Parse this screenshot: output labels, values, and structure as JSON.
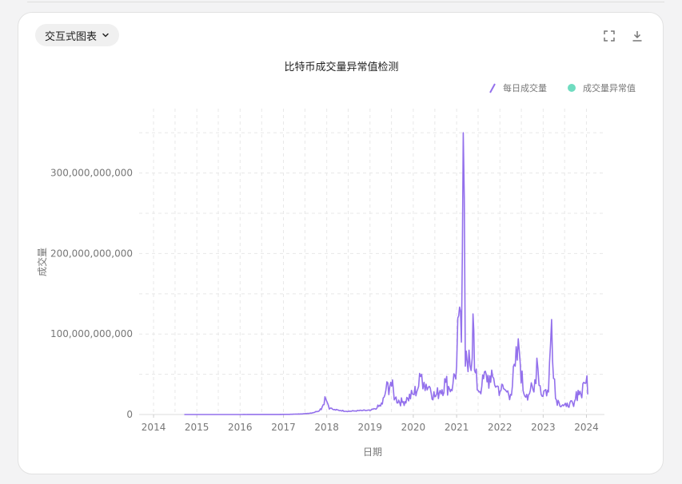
{
  "toolbar": {
    "chart_type_label": "交互式图表",
    "fullscreen_icon": "fullscreen-icon",
    "download_icon": "download-icon"
  },
  "colors": {
    "series_line": "#9370ec",
    "anomaly_marker": "#6fdcc0",
    "grid": "#e8e8e8",
    "axis_text": "#777777"
  },
  "chart_data": {
    "type": "line",
    "title": "比特币成交量异常值检测",
    "xlabel": "日期",
    "ylabel": "成交量",
    "xlim": [
      "2013-09-01",
      "2024-06-01"
    ],
    "ylim": [
      0,
      380000000000
    ],
    "x_ticks": [
      "2014",
      "2015",
      "2016",
      "2017",
      "2018",
      "2019",
      "2020",
      "2021",
      "2022",
      "2023",
      "2024"
    ],
    "y_ticks": [
      {
        "value": 0,
        "label": "0"
      },
      {
        "value": 100000000000,
        "label": "100,000,000,000"
      },
      {
        "value": 200000000000,
        "label": "200,000,000,000"
      },
      {
        "value": 300000000000,
        "label": "300,000,000,000"
      }
    ],
    "grid": true,
    "legend_position": "top-right",
    "legend": [
      {
        "label": "每日成交量",
        "kind": "line"
      },
      {
        "label": "成交量异常值",
        "kind": "marker"
      }
    ],
    "series": [
      {
        "name": "每日成交量",
        "x": [
          "2014-09-17",
          "2015-03-01",
          "2015-09-01",
          "2016-03-01",
          "2016-09-01",
          "2017-01-01",
          "2017-03-01",
          "2017-05-01",
          "2017-07-01",
          "2017-09-01",
          "2017-11-01",
          "2017-12-01",
          "2017-12-17",
          "2018-01-05",
          "2018-02-01",
          "2018-03-01",
          "2018-05-01",
          "2018-07-01",
          "2018-09-01",
          "2018-11-01",
          "2019-01-01",
          "2019-03-01",
          "2019-04-15",
          "2019-05-15",
          "2019-06-25",
          "2019-08-01",
          "2019-10-01",
          "2019-11-15",
          "2020-01-01",
          "2020-02-15",
          "2020-03-12",
          "2020-04-01",
          "2020-05-15",
          "2020-07-01",
          "2020-08-15",
          "2020-10-01",
          "2020-11-01",
          "2020-12-01",
          "2021-01-01",
          "2021-01-11",
          "2021-02-10",
          "2021-02-26",
          "2021-03-15",
          "2021-04-15",
          "2021-05-12",
          "2021-05-19",
          "2021-06-01",
          "2021-07-01",
          "2021-08-01",
          "2021-09-07",
          "2021-10-15",
          "2021-11-10",
          "2021-12-04",
          "2022-01-10",
          "2022-02-01",
          "2022-03-01",
          "2022-04-01",
          "2022-05-10",
          "2022-06-13",
          "2022-07-15",
          "2022-08-15",
          "2022-09-15",
          "2022-10-15",
          "2022-11-09",
          "2022-12-15",
          "2023-01-15",
          "2023-02-15",
          "2023-03-13",
          "2023-04-15",
          "2023-05-15",
          "2023-06-15",
          "2023-07-15",
          "2023-08-15",
          "2023-09-15",
          "2023-10-23",
          "2023-11-15",
          "2023-12-10",
          "2024-01-05",
          "2024-01-12"
        ],
        "values": [
          20000000,
          30000000,
          40000000,
          50000000,
          80000000,
          150000000,
          250000000,
          600000000,
          1000000000,
          2000000000,
          5000000000,
          12000000000,
          22000000000,
          15000000000,
          8000000000,
          6000000000,
          5000000000,
          4000000000,
          4500000000,
          5000000000,
          5000000000,
          8000000000,
          13000000000,
          30000000000,
          40000000000,
          20000000000,
          15000000000,
          20000000000,
          25000000000,
          35000000000,
          50000000000,
          40000000000,
          35000000000,
          22000000000,
          30000000000,
          40000000000,
          32000000000,
          38000000000,
          60000000000,
          120000000000,
          90000000000,
          350000000000,
          60000000000,
          80000000000,
          70000000000,
          125000000000,
          55000000000,
          30000000000,
          35000000000,
          50000000000,
          40000000000,
          45000000000,
          35000000000,
          30000000000,
          32000000000,
          28000000000,
          25000000000,
          60000000000,
          80000000000,
          30000000000,
          25000000000,
          30000000000,
          28000000000,
          70000000000,
          25000000000,
          30000000000,
          28000000000,
          118000000000,
          20000000000,
          15000000000,
          12000000000,
          10000000000,
          15000000000,
          10000000000,
          30000000000,
          25000000000,
          40000000000,
          48000000000,
          25000000000
        ]
      }
    ]
  }
}
